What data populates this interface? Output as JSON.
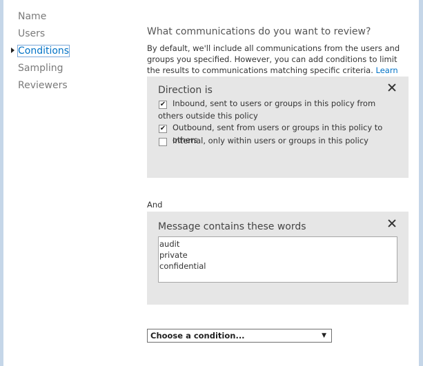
{
  "nav": {
    "items": [
      {
        "label": "Name"
      },
      {
        "label": "Users"
      },
      {
        "label": "Conditions"
      },
      {
        "label": "Sampling"
      },
      {
        "label": "Reviewers"
      }
    ],
    "active_index": 2
  },
  "main": {
    "question": "What communications do you want to review?",
    "description": "By default, we'll include all communications from the users and groups you specified. However, you can add conditions to limit the results to communications matching specific criteria.",
    "learn_more": "Learn more"
  },
  "direction_panel": {
    "title": "Direction is",
    "options": [
      {
        "label": "Inbound, sent to users or groups in this policy from others outside this policy",
        "checked": true
      },
      {
        "label": "Outbound, sent from users or groups in this policy to others",
        "checked": true
      },
      {
        "label": "Internal, only within users or groups in this policy",
        "checked": false
      }
    ]
  },
  "and_label": "And",
  "words_panel": {
    "title": "Message contains these words",
    "words": [
      "audit",
      "private",
      "confidential"
    ]
  },
  "condition_select": {
    "value": "Choose a condition...",
    "arrow": "▼"
  },
  "checkmark": "✔"
}
